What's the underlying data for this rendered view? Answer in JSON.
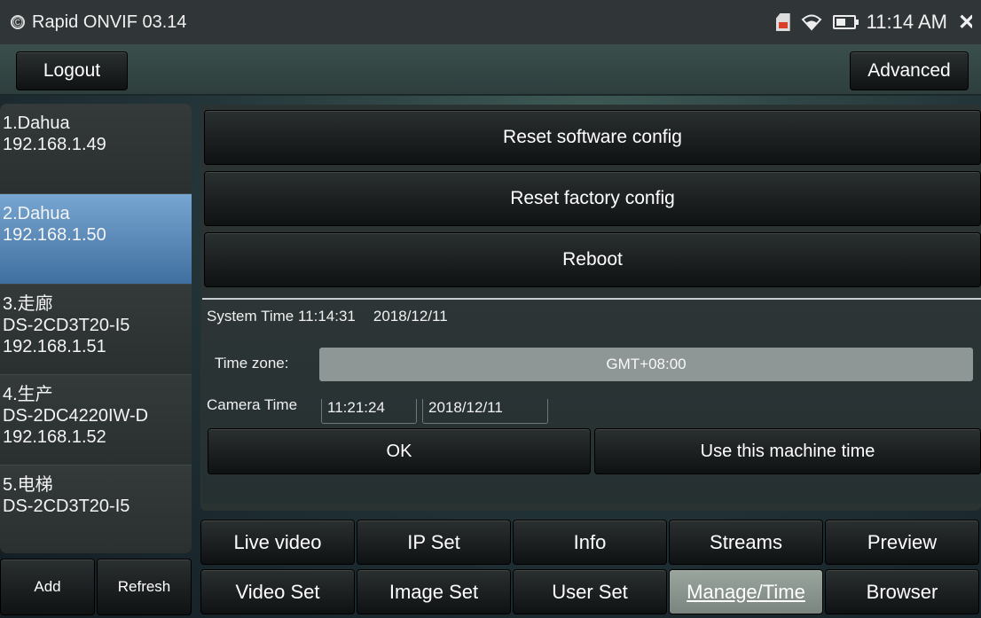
{
  "statusbar": {
    "app_title": "Rapid ONVIF 03.14",
    "clock": "11:14 AM",
    "icons": [
      "copyright-icon",
      "sd-card-icon",
      "wifi-icon",
      "battery-icon",
      "close-icon"
    ]
  },
  "toolbar": {
    "logout_label": "Logout",
    "advanced_label": "Advanced"
  },
  "devices": [
    {
      "lines": [
        "1.Dahua",
        "192.168.1.49"
      ],
      "selected": false
    },
    {
      "lines": [
        "2.Dahua",
        "192.168.1.50"
      ],
      "selected": true
    },
    {
      "lines": [
        "3.走廊",
        "DS-2CD3T20-I5",
        "192.168.1.51"
      ],
      "selected": false
    },
    {
      "lines": [
        "4.生产",
        "DS-2DC4220IW-D",
        "192.168.1.52"
      ],
      "selected": false
    },
    {
      "lines": [
        "5.电梯",
        "DS-2CD3T20-I5"
      ],
      "selected": false
    }
  ],
  "list_actions": {
    "add_label": "Add",
    "refresh_label": "Refresh"
  },
  "manage": {
    "reset_software_label": "Reset software config",
    "reset_factory_label": "Reset factory config",
    "reboot_label": "Reboot",
    "system_time_label": "System Time 11:14:31",
    "system_date": "2018/12/11",
    "timezone_label": "Time zone:",
    "timezone_value": "GMT+08:00",
    "camera_time_label": "Camera Time",
    "camera_time": "11:21:24",
    "camera_date": "2018/12/11",
    "ok_label": "OK",
    "use_machine_time_label": "Use this machine time"
  },
  "tabs": {
    "row1": [
      "Live video",
      "IP Set",
      "Info",
      "Streams",
      "Preview"
    ],
    "row2": [
      "Video Set",
      "Image Set",
      "User Set",
      "Manage/Time",
      "Browser"
    ],
    "active": "Manage/Time"
  },
  "colors": {
    "selected_item": "#5a8bbd",
    "active_tab": "#8d978f",
    "timezone_field": "#8e9696"
  }
}
